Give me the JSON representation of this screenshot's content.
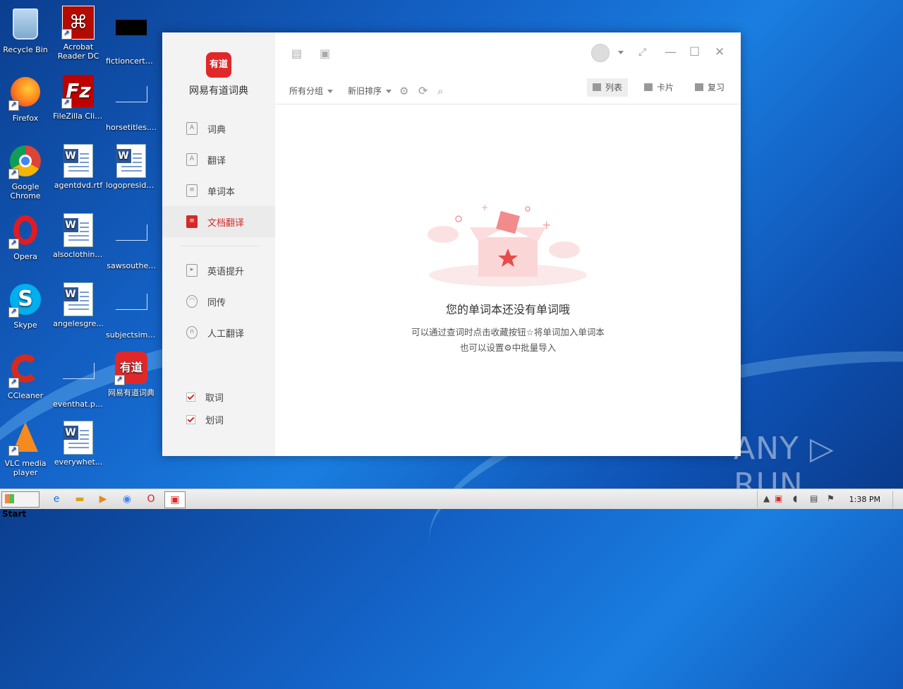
{
  "desktop": {
    "icons": [
      {
        "label": "Recycle Bin"
      },
      {
        "label": "Acrobat Reader DC"
      },
      {
        "label": "fictioncertai..."
      },
      {
        "label": "Firefox"
      },
      {
        "label": "FileZilla Client"
      },
      {
        "label": "horsetitles...."
      },
      {
        "label": "Google Chrome"
      },
      {
        "label": "agentdvd.rtf"
      },
      {
        "label": "logopreside..."
      },
      {
        "label": "Opera"
      },
      {
        "label": "alsoclothing..."
      },
      {
        "label": "sawsouthe..."
      },
      {
        "label": "Skype"
      },
      {
        "label": "angelesgre..."
      },
      {
        "label": "subjectsimp..."
      },
      {
        "label": "CCleaner"
      },
      {
        "label": "eventhat.png"
      },
      {
        "label": "网易有道词典"
      },
      {
        "label": "VLC media player"
      },
      {
        "label": "everywhet..."
      }
    ]
  },
  "app": {
    "logo_text": "有道",
    "name": "网易有道词典",
    "nav": [
      {
        "label": "词典",
        "icon": "dictionary-icon"
      },
      {
        "label": "翻译",
        "icon": "translate-icon"
      },
      {
        "label": "单词本",
        "icon": "wordbook-icon"
      },
      {
        "label": "文档翻译",
        "icon": "document-translate-icon"
      },
      {
        "label": "英语提升",
        "icon": "video-course-icon"
      },
      {
        "label": "同传",
        "icon": "simultaneous-icon"
      },
      {
        "label": "人工翻译",
        "icon": "human-translate-icon"
      }
    ],
    "toggles": [
      {
        "label": "取词"
      },
      {
        "label": "划词"
      }
    ],
    "filters": {
      "group": "所有分组",
      "sort": "新旧排序"
    },
    "views": {
      "list": "列表",
      "card": "卡片",
      "review": "复习"
    },
    "empty": {
      "title": "您的单词本还没有单词哦",
      "line1": "可以通过查词时点击收藏按钮☆将单词加入单词本",
      "line2": "也可以设置⚙中批量导入"
    },
    "accent_color": "#d52a2a"
  },
  "taskbar": {
    "start": "Start",
    "clock": "1:38 PM"
  },
  "watermark": "ANY ▷ RUN"
}
